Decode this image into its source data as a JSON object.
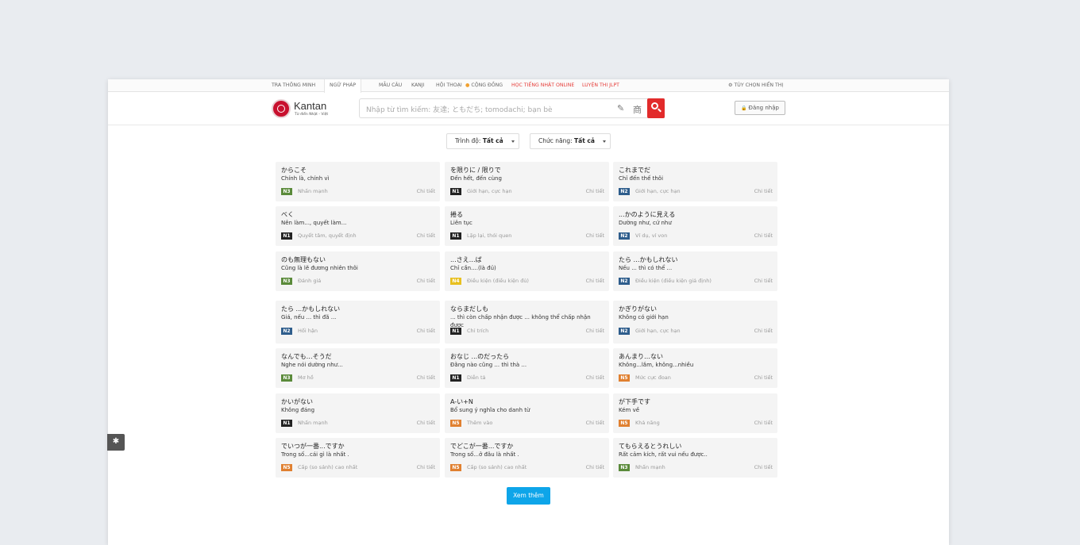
{
  "topnav": {
    "items": [
      {
        "label": "TRA THÔNG MINH"
      },
      {
        "label": "NGỮ PHÁP"
      },
      {
        "label": "MẪU CÂU"
      },
      {
        "label": "KANJI"
      },
      {
        "label": "HỘI THOẠI"
      },
      {
        "label": "CỘNG ĐỒNG"
      },
      {
        "label": "HỌC TIẾNG NHẬT ONLINE"
      },
      {
        "label": "LUYỆN THI JLPT"
      }
    ],
    "options_label": "TÙY CHỌN HIỂN THỊ",
    "accent_color": "#e53935"
  },
  "header": {
    "logo_name": "Kantan",
    "logo_sub": "Từ điển Nhật - Việt",
    "search_placeholder": "Nhập từ tìm kiếm: 友達; ともだち; tomodachi; bạn bè",
    "pencil_icon": "✎",
    "kanji_icon": "商",
    "login_label": "Đăng nhập",
    "lock_icon": "🔒"
  },
  "filters": {
    "level_label": "Trình độ:",
    "level_value": "Tất cả",
    "function_label": "Chức năng:",
    "function_value": "Tất cả"
  },
  "level_colors": {
    "N1": "#222222",
    "N2": "#2e5d8c",
    "N3": "#5a8a3a",
    "N4": "#e8c020",
    "N5": "#e08030"
  },
  "cards": [
    {
      "jp": "からこそ",
      "vn": "Chính là, chính vì",
      "level": "N3",
      "type": "Nhấn mạnh",
      "detail": "Chi tiết"
    },
    {
      "jp": "を限りに / 限りで",
      "vn": "Đến hết, đến cùng",
      "level": "N1",
      "type": "Giới hạn, cực hạn",
      "detail": "Chi tiết"
    },
    {
      "jp": "これまでだ",
      "vn": "Chỉ đến thế thôi",
      "level": "N2",
      "type": "Giới hạn, cực hạn",
      "detail": "Chi tiết"
    },
    {
      "jp": "べく",
      "vn": "Nên làm..., quyết làm...",
      "level": "N1",
      "type": "Quyết tâm, quyết định",
      "detail": "Chi tiết"
    },
    {
      "jp": "捲る",
      "vn": "Liên tục",
      "level": "N1",
      "type": "Lặp lại, thói quen",
      "detail": "Chi tiết"
    },
    {
      "jp": "...かのように見える",
      "vn": "Dường như, cứ như",
      "level": "N2",
      "type": "Ví dụ, ví von",
      "detail": "Chi tiết"
    },
    {
      "jp": "のも無理もない",
      "vn": "Cũng là lẽ đương nhiên thôi",
      "level": "N3",
      "type": "Đánh giá",
      "detail": "Chi tiết"
    },
    {
      "jp": "...さえ…ば",
      "vn": "Chỉ cần....(là đủ)",
      "level": "N4",
      "type": "Điều kiện (điều kiện đủ)",
      "detail": "Chi tiết"
    },
    {
      "jp": "たら …かもしれない",
      "vn": "Nếu ... thì có thể ...",
      "level": "N2",
      "type": "Điều kiện (điều kiện giả định)",
      "detail": "Chi tiết"
    },
    {
      "jp": "たら ...かもしれない",
      "vn": "Giá, nếu ... thì đã ...",
      "level": "N2",
      "type": "Hối hận",
      "detail": "Chi tiết"
    },
    {
      "jp": "ならまだしも",
      "vn": "... thì còn chấp nhận được ... không thể chấp nhận được",
      "level": "N1",
      "type": "Chỉ trích",
      "detail": "Chi tiết"
    },
    {
      "jp": "かぎりがない",
      "vn": "Không có giới hạn",
      "level": "N2",
      "type": "Giới hạn, cực hạn",
      "detail": "Chi tiết"
    },
    {
      "jp": "なんでも…そうだ",
      "vn": "Nghe nói dường như...",
      "level": "N3",
      "type": "Mơ hồ",
      "detail": "Chi tiết"
    },
    {
      "jp": "おなじ ...のだったら",
      "vn": "Đằng nào cũng ... thì thà ...",
      "level": "N1",
      "type": "Diễn tả",
      "detail": "Chi tiết"
    },
    {
      "jp": "あんまり…ない",
      "vn": "Không...lắm, không...nhiều",
      "level": "N5",
      "type": "Mức cực đoan",
      "detail": "Chi tiết"
    },
    {
      "jp": "かいがない",
      "vn": "Không đáng",
      "level": "N1",
      "type": "Nhấn mạnh",
      "detail": "Chi tiết"
    },
    {
      "jp": "A-い+N",
      "vn": "Bổ sung ý nghĩa cho danh từ",
      "level": "N5",
      "type": "Thêm vào",
      "detail": "Chi tiết"
    },
    {
      "jp": "が下手です",
      "vn": "Kém về",
      "level": "N5",
      "type": "Khả năng",
      "detail": "Chi tiết"
    },
    {
      "jp": "でいつが一番...ですか",
      "vn": "Trong số...cái gì là nhất .",
      "level": "N5",
      "type": "Cấp (so sánh) cao nhất",
      "detail": "Chi tiết"
    },
    {
      "jp": "でどこが一番...ですか",
      "vn": "Trong số...ở đâu là nhất .",
      "level": "N5",
      "type": "Cấp (so sánh) cao nhất",
      "detail": "Chi tiết"
    },
    {
      "jp": "てもらえるとうれしい",
      "vn": "Rất cảm kích, rất vui nếu được..",
      "level": "N3",
      "type": "Nhấn mạnh",
      "detail": "Chi tiết"
    }
  ],
  "more_button": "Xem thêm",
  "bug_icon": "✱"
}
